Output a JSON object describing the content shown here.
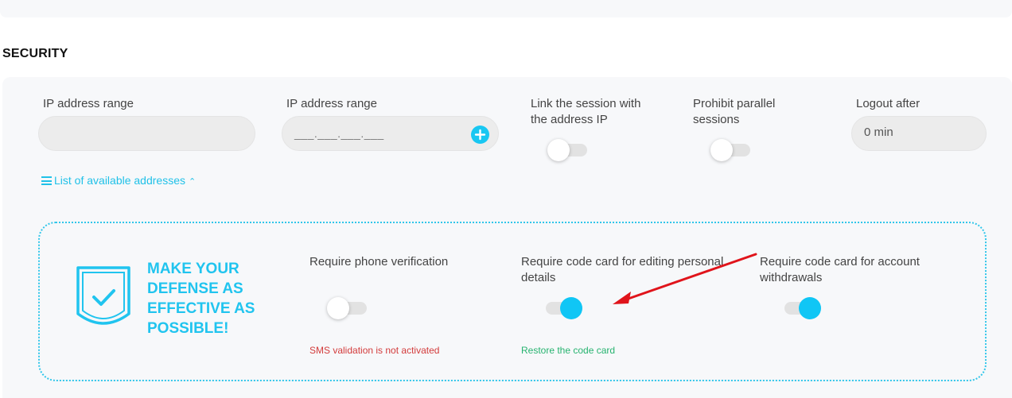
{
  "section": {
    "title": "SECURITY"
  },
  "fields": {
    "ip_range_1": {
      "label": "IP address range",
      "value": ""
    },
    "ip_range_2": {
      "label": "IP address range",
      "placeholder": "___.___.___.___"
    },
    "link_session": {
      "label_line1": "Link the session with",
      "label_line2": "the address IP",
      "enabled": false
    },
    "prohibit_parallel": {
      "label_line1": "Prohibit parallel",
      "label_line2": "sessions",
      "enabled": false
    },
    "logout_after": {
      "label": "Logout after",
      "value": "0 min"
    }
  },
  "list_link": {
    "label": "List of available addresses"
  },
  "promo": {
    "lines": [
      "MAKE YOUR",
      "DEFENSE AS",
      "EFFECTIVE AS",
      "POSSIBLE!"
    ],
    "phone": {
      "label": "Require phone verification",
      "enabled": false,
      "note": "SMS validation is not activated"
    },
    "code_personal": {
      "label_line1": "Require code card for editing personal",
      "label_line2": "details",
      "enabled": true,
      "note": "Restore the code card"
    },
    "code_withdrawals": {
      "label_line1": "Require code card for account",
      "label_line2": "withdrawals",
      "enabled": true
    }
  },
  "colors": {
    "accent": "#10c6f5",
    "error": "#d33b3b",
    "success": "#26b36f",
    "annotation_arrow": "#e0141b"
  }
}
